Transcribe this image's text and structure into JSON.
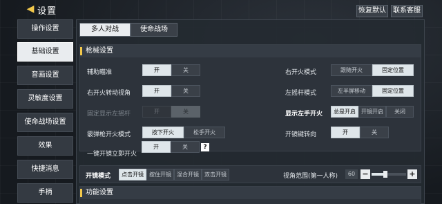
{
  "header": {
    "back_icon": "back-chevron-icon",
    "title": "设置",
    "restore_default": "恢复默认",
    "contact_support": "联系客服"
  },
  "sidebar": {
    "items": [
      {
        "label": "操作设置",
        "active": false
      },
      {
        "label": "基础设置",
        "active": true
      },
      {
        "label": "音画设置",
        "active": false
      },
      {
        "label": "灵敏度设置",
        "active": false
      },
      {
        "label": "使命战场设置",
        "active": false
      },
      {
        "label": "效果",
        "active": false
      },
      {
        "label": "快捷消息",
        "active": false
      },
      {
        "label": "手柄",
        "active": false
      }
    ]
  },
  "tabs": [
    {
      "label": "多人对战",
      "active": true
    },
    {
      "label": "使命战场",
      "active": false
    }
  ],
  "gun_section": {
    "title": "枪械设置",
    "rows": [
      {
        "label": "辅助瞄准",
        "options": [
          "开",
          "关"
        ],
        "selected": 0
      },
      {
        "label": "右开火转动视角",
        "options": [
          "开",
          "关"
        ],
        "selected": 0
      },
      {
        "label": "固定显示左摇杆",
        "options": [
          "开",
          "关"
        ],
        "selected": 1,
        "disabled": true
      },
      {
        "label": "霰弹枪开火模式",
        "options": [
          "按下开火",
          "松手开火"
        ],
        "selected": 0
      },
      {
        "label": "一键开镜立即开火",
        "options": [
          "开",
          "关"
        ],
        "selected": 0
      }
    ],
    "right_rows": [
      {
        "label": "右开火模式",
        "options": [
          "跟随开火",
          "固定位置"
        ],
        "selected": 1
      },
      {
        "label": "左摇杆模式",
        "options": [
          "左半屏移动",
          "固定位置"
        ],
        "selected": 1
      },
      {
        "label": "显示左手开火",
        "options": [
          "总是开启",
          "开镜开启",
          "关闭"
        ],
        "selected": 0
      },
      {
        "label": "开镜键转向",
        "options": [
          "开",
          "关"
        ],
        "selected": 0
      }
    ],
    "help_icon": "?"
  },
  "scope_mode": {
    "label": "开镜模式",
    "options": [
      "点击开镜",
      "按住开镜",
      "混合开镜",
      "双击开镜"
    ],
    "selected": 0,
    "fov_label": "视角范围(第一人称)",
    "fov_value": "60",
    "fov_fraction": 0.4,
    "minus": "−",
    "plus": "+"
  },
  "func_section": {
    "title": "功能设置"
  }
}
